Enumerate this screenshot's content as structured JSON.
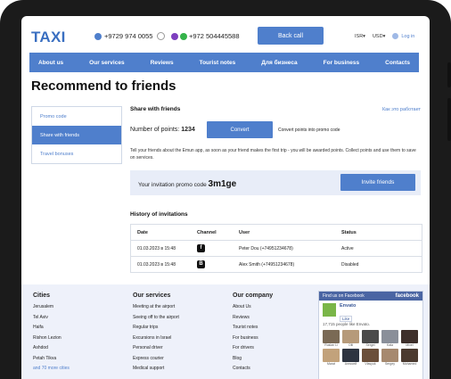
{
  "header": {
    "logo": "TAXI",
    "phone1": "+9729 974 0055",
    "phone2": "+972 504445588",
    "callback_label": "Back call",
    "currency1": "ISR",
    "currency2": "USD",
    "login_label": "Log in"
  },
  "nav": {
    "items": [
      "About us",
      "Our services",
      "Reviews",
      "Tourist notes",
      "Для бизнеса",
      "For business",
      "Contacts"
    ]
  },
  "page_title": "Recommend to friends",
  "sidebar": {
    "items": [
      {
        "label": "Promo code",
        "active": false
      },
      {
        "label": "Share with friends",
        "active": true
      },
      {
        "label": "Travel bonuses",
        "active": false
      }
    ]
  },
  "share": {
    "heading": "Share with friends",
    "how_link": "Как это работает",
    "points_label": "Number of points:",
    "points_value": "1234",
    "convert_label": "Convert",
    "convert_note": "Convert points into promo code",
    "description": "Tell your friends about the Emun app, as soon as your friend makes the first trip - you will be awarded points. Collect points and use them to save on services.",
    "promo_label": "Your invitation promo code",
    "promo_code": "3m1ge",
    "invite_label": "Invite friends"
  },
  "history": {
    "heading": "History of invitations",
    "columns": [
      "Date",
      "Channel",
      "User",
      "Status"
    ],
    "rows": [
      {
        "date": "01.03.2023 в 15:48",
        "channel": "f",
        "user": "Peter Dou (+74951234678)",
        "status": "Active"
      },
      {
        "date": "01.03.2023 в 15:48",
        "channel": "B",
        "user": "Alex Smith (+74951234678)",
        "status": "Disabled"
      }
    ]
  },
  "footer": {
    "cities": {
      "heading": "Cities",
      "items": [
        "Jerusalem",
        "Tel Aviv",
        "Haifa",
        "Rishon Lezion",
        "Ashdod",
        "Petah Tikva"
      ],
      "more": "and 70 more cities"
    },
    "services": {
      "heading": "Our services",
      "items": [
        "Meeting at the airport",
        "Seeing off to the airport",
        "Regular trips",
        "Excursions in Israel",
        "Personal driver",
        "Express courier",
        "Medical support"
      ]
    },
    "company": {
      "heading": "Our company",
      "items": [
        "About Us",
        "Reviews",
        "Tourist notes",
        "For business",
        "For drivers",
        "Blog",
        "Contacts"
      ]
    },
    "facebook": {
      "bar_label": "Find us on Facebook",
      "brand": "facebook",
      "page_name": "Envato",
      "like_label": "Like",
      "count_text": "17,715 people like Envato.",
      "faces": [
        "Ruslan  Li",
        "Olli",
        "Sergei",
        "Kala",
        "Mixel",
        "Marat",
        "Алексей",
        "Vlasyuk",
        "Sergey",
        "Mohamed"
      ],
      "face_colors": [
        "#7a6a55",
        "#b69a7a",
        "#4a4a4a",
        "#8a8f99",
        "#3e2f2a",
        "#c2a27b",
        "#2e3440",
        "#6b4f3a",
        "#a6896f",
        "#4b3a2f"
      ]
    }
  },
  "colors": {
    "accent": "#4f7fcc",
    "viber": "#7d3fbf",
    "whatsapp": "#34b34a"
  }
}
